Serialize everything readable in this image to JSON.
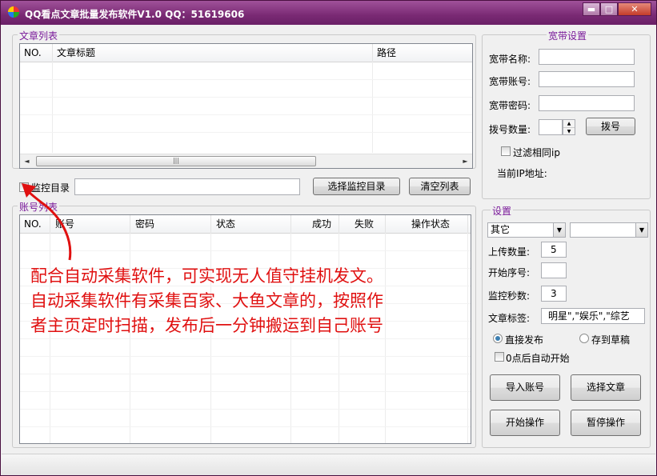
{
  "window": {
    "title": "QQ看点文章批量发布软件V1.0  QQ：51619606",
    "minimize_glyph": "▬",
    "maximize_glyph": "□",
    "close_glyph": "✕"
  },
  "article_list": {
    "group_title": "文章列表",
    "columns": [
      "NO.",
      "文章标题",
      "路径"
    ],
    "scroll_left": "◄",
    "scroll_right": "►",
    "scroll_thumb": "|||"
  },
  "monitor": {
    "checkbox_label": "监控目录",
    "path_value": "",
    "select_dir_button": "选择监控目录",
    "clear_list_button": "清空列表"
  },
  "account_list": {
    "group_title": "账号列表",
    "columns": [
      "NO.",
      "账号",
      "密码",
      "状态",
      "成功",
      "失败",
      "操作状态"
    ]
  },
  "broadband": {
    "group_title": "宽带设置",
    "name_label": "宽带名称:",
    "name_value": "",
    "account_label": "宽带账号:",
    "account_value": "",
    "password_label": "宽带密码:",
    "password_value": "",
    "dial_count_label": "拨号数量:",
    "dial_count_value": "",
    "dial_button": "拨号",
    "filter_ip_label": "过滤相同ip",
    "current_ip_label": "当前IP地址:",
    "current_ip_value": ""
  },
  "settings": {
    "group_title": "设置",
    "select1_value": "其它",
    "select2_value": "",
    "upload_count_label": "上传数量:",
    "upload_count_value": "5",
    "start_index_label": "开始序号:",
    "start_index_value": "",
    "monitor_seconds_label": "监控秒数:",
    "monitor_seconds_value": "3",
    "tags_label": "文章标签:",
    "tags_value": "明星\",\"娱乐\",\"综艺",
    "publish_direct_label": "直接发布",
    "save_draft_label": "存到草稿",
    "auto_start_label": "0点后自动开始",
    "import_accounts_button": "导入账号",
    "select_article_button": "选择文章",
    "start_button": "开始操作",
    "pause_button": "暂停操作"
  },
  "annotation": {
    "lines": [
      "配合自动采集软件，可实现无人值守挂机发文。",
      "自动采集软件有采集百家、大鱼文章的，按照作",
      "者主页定时扫描，发布后一分钟搬运到自己账号"
    ],
    "color": "#e01010"
  },
  "colors": {
    "titlebar": "#7a2a74",
    "group_title": "#7a1a9a"
  }
}
